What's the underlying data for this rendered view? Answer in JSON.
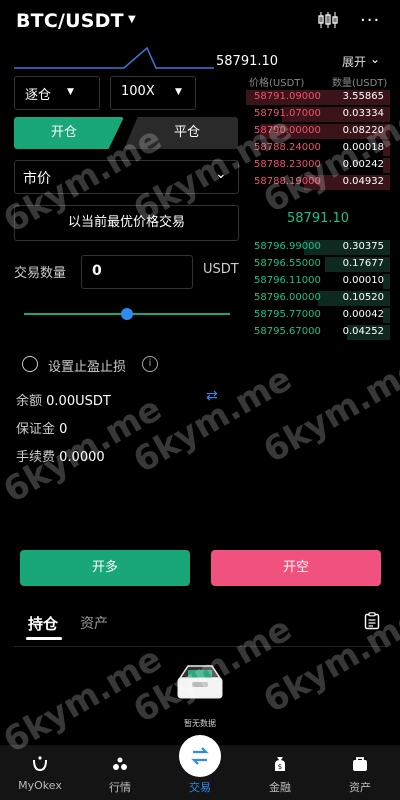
{
  "header": {
    "pair": "BTC/USDT"
  },
  "top": {
    "last_price": "58791.10",
    "expand": "展开"
  },
  "orderbook": {
    "price_header": "价格(USDT)",
    "qty_header": "数量(USDT)",
    "asks": [
      {
        "price": "58791.09000",
        "qty": "3.55865",
        "depth": 1.0
      },
      {
        "price": "58791.07000",
        "qty": "0.03334",
        "depth": 0.75
      },
      {
        "price": "58790.00000",
        "qty": "0.08220",
        "depth": 0.9
      },
      {
        "price": "58788.24000",
        "qty": "0.00018",
        "depth": 0.05
      },
      {
        "price": "58788.23000",
        "qty": "0.00242",
        "depth": 0.05
      },
      {
        "price": "58788.19000",
        "qty": "0.04932",
        "depth": 0.6
      }
    ],
    "mid_price": "58791.10",
    "bids": [
      {
        "price": "58796.99000",
        "qty": "0.30375",
        "depth": 0.6
      },
      {
        "price": "58796.55000",
        "qty": "0.17677",
        "depth": 0.45
      },
      {
        "price": "58796.11000",
        "qty": "0.00010",
        "depth": 0.05
      },
      {
        "price": "58796.00000",
        "qty": "0.10520",
        "depth": 0.5
      },
      {
        "price": "58795.77000",
        "qty": "0.00042",
        "depth": 0.05
      },
      {
        "price": "58795.67000",
        "qty": "0.04252",
        "depth": 0.3
      }
    ],
    "ask_color": "#f0516f",
    "bid_color": "#19c18a"
  },
  "form": {
    "margin_mode": "逐仓",
    "leverage": "100X",
    "tab_open": "开仓",
    "tab_close": "平仓",
    "order_type": "市价",
    "best_price_btn": "以当前最优价格交易",
    "qty_label": "交易数量",
    "qty_value": "0",
    "qty_unit": "USDT",
    "slider_value": 0.5,
    "tpsl_label": "设置止盈止损",
    "balance_label": "余额",
    "balance_value": "0.00USDT",
    "margin_label": "保证金",
    "margin_value": "0",
    "fee_label": "手续费",
    "fee_value": "0.0000"
  },
  "actions": {
    "long": "开多",
    "short": "开空"
  },
  "positions": {
    "tab_positions": "持仓",
    "tab_assets": "资产",
    "empty": "暂无数据"
  },
  "nav": [
    {
      "label": "MyOkex",
      "icon": "profile-icon"
    },
    {
      "label": "行情",
      "icon": "market-icon"
    },
    {
      "label": "交易",
      "icon": "trade-icon"
    },
    {
      "label": "金融",
      "icon": "finance-icon"
    },
    {
      "label": "资产",
      "icon": "assets-icon"
    }
  ],
  "watermark": "6kym.me",
  "colors": {
    "green": "#19a77a",
    "pink": "#f0517f",
    "blue": "#2d8cf0"
  }
}
